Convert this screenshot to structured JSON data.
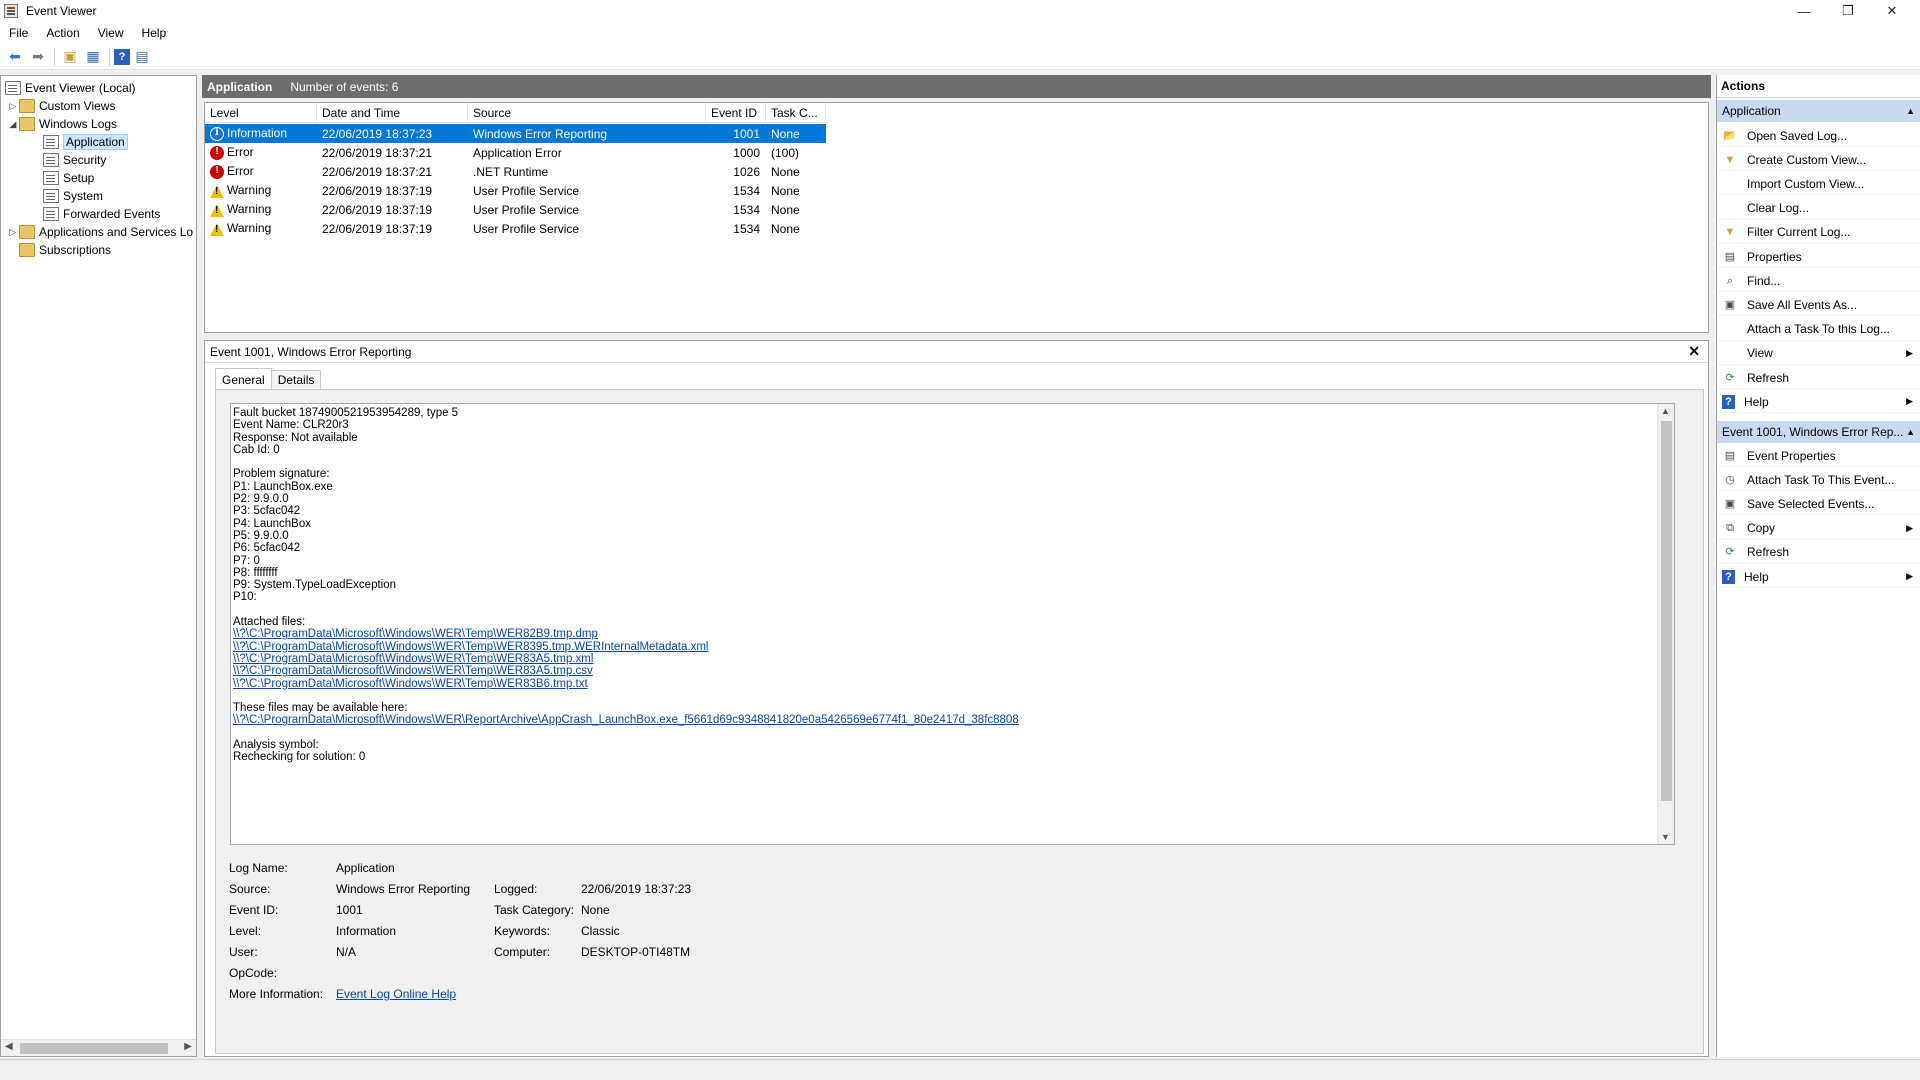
{
  "window": {
    "title": "Event Viewer",
    "minimize": "—",
    "restore": "❐",
    "close": "✕"
  },
  "menu": [
    "File",
    "Action",
    "View",
    "Help"
  ],
  "toolbar": {
    "back": "⬅",
    "forward": "➡",
    "up": "▣",
    "show_hide": "▦",
    "help": "?",
    "console": "▤"
  },
  "tree": {
    "root": "Event Viewer (Local)",
    "custom_views": "Custom Views",
    "windows_logs": "Windows Logs",
    "logs": [
      "Application",
      "Security",
      "Setup",
      "System",
      "Forwarded Events"
    ],
    "apps_services": "Applications and Services Lo",
    "subscriptions": "Subscriptions",
    "selected": "Application"
  },
  "center": {
    "log_name": "Application",
    "count_text": "Number of events: 6",
    "columns": [
      "Level",
      "Date and Time",
      "Source",
      "Event ID",
      "Task C..."
    ],
    "rows": [
      {
        "level": "Information",
        "icon": "information-icon",
        "date": "22/06/2019 18:37:23",
        "source": "Windows Error Reporting",
        "event_id": "1001",
        "task": "None"
      },
      {
        "level": "Error",
        "icon": "error-icon",
        "date": "22/06/2019 18:37:21",
        "source": "Application Error",
        "event_id": "1000",
        "task": "(100)"
      },
      {
        "level": "Error",
        "icon": "error-icon",
        "date": "22/06/2019 18:37:21",
        "source": ".NET Runtime",
        "event_id": "1026",
        "task": "None"
      },
      {
        "level": "Warning",
        "icon": "warning-icon",
        "date": "22/06/2019 18:37:19",
        "source": "User Profile Service",
        "event_id": "1534",
        "task": "None"
      },
      {
        "level": "Warning",
        "icon": "warning-icon",
        "date": "22/06/2019 18:37:19",
        "source": "User Profile Service",
        "event_id": "1534",
        "task": "None"
      },
      {
        "level": "Warning",
        "icon": "warning-icon",
        "date": "22/06/2019 18:37:19",
        "source": "User Profile Service",
        "event_id": "1534",
        "task": "None"
      }
    ]
  },
  "detail": {
    "title": "Event 1001, Windows Error Reporting",
    "close": "✕",
    "tabs": [
      "General",
      "Details"
    ],
    "description_lines": [
      "Fault bucket 1874900521953954289, type 5",
      "Event Name: CLR20r3",
      "Response: Not available",
      "Cab Id: 0",
      "",
      "Problem signature:",
      "P1: LaunchBox.exe",
      "P2: 9.9.0.0",
      "P3: 5cfac042",
      "P4: LaunchBox",
      "P5: 9.9.0.0",
      "P6: 5cfac042",
      "P7: 0",
      "P8: ffffffff",
      "P9: System.TypeLoadException",
      "P10:",
      "",
      "Attached files:"
    ],
    "attached_files": [
      "\\\\?\\C:\\ProgramData\\Microsoft\\Windows\\WER\\Temp\\WER82B9.tmp.dmp",
      "\\\\?\\C:\\ProgramData\\Microsoft\\Windows\\WER\\Temp\\WER8395.tmp.WERInternalMetadata.xml",
      "\\\\?\\C:\\ProgramData\\Microsoft\\Windows\\WER\\Temp\\WER83A5.tmp.xml",
      "\\\\?\\C:\\ProgramData\\Microsoft\\Windows\\WER\\Temp\\WER83A5.tmp.csv",
      "\\\\?\\C:\\ProgramData\\Microsoft\\Windows\\WER\\Temp\\WER83B6.tmp.txt"
    ],
    "available_here_label": "These files may be available here:",
    "archive_path": "\\\\?\\C:\\ProgramData\\Microsoft\\Windows\\WER\\ReportArchive\\AppCrash_LaunchBox.exe_f5661d69c9348841820e0a5426569e6774f1_80e2417d_38fc8808",
    "analysis_lines": [
      "Analysis symbol:",
      "Rechecking for solution: 0"
    ],
    "props": {
      "log_name_label": "Log Name:",
      "log_name": "Application",
      "source_label": "Source:",
      "source": "Windows Error Reporting",
      "logged_label": "Logged:",
      "logged": "22/06/2019 18:37:23",
      "event_id_label": "Event ID:",
      "event_id": "1001",
      "task_category_label": "Task Category:",
      "task_category": "None",
      "level_label": "Level:",
      "level": "Information",
      "keywords_label": "Keywords:",
      "keywords": "Classic",
      "user_label": "User:",
      "user": "N/A",
      "computer_label": "Computer:",
      "computer": "DESKTOP-0TI48TM",
      "opcode_label": "OpCode:",
      "more_info_label": "More Information:",
      "more_info_link": "Event Log Online Help"
    }
  },
  "actions": {
    "title": "Actions",
    "section1": "Application",
    "items1": [
      {
        "label": "Open Saved Log...",
        "icon": "folder-open-icon",
        "glyph": "📂",
        "submenu": false
      },
      {
        "label": "Create Custom View...",
        "icon": "filter-icon",
        "glyph": "▼",
        "submenu": false
      },
      {
        "label": "Import Custom View...",
        "icon": "",
        "glyph": "",
        "submenu": false
      },
      {
        "label": "Clear Log...",
        "icon": "",
        "glyph": "",
        "submenu": false
      },
      {
        "label": "Filter Current Log...",
        "icon": "filter-icon",
        "glyph": "▼",
        "submenu": false
      },
      {
        "label": "Properties",
        "icon": "properties-icon",
        "glyph": "▤",
        "submenu": false
      },
      {
        "label": "Find...",
        "icon": "binoculars-icon",
        "glyph": "⌕",
        "submenu": false
      },
      {
        "label": "Save All Events As...",
        "icon": "save-icon",
        "glyph": "▣",
        "submenu": false
      },
      {
        "label": "Attach a Task To this Log...",
        "icon": "",
        "glyph": "",
        "submenu": false
      },
      {
        "label": "View",
        "icon": "",
        "glyph": "",
        "submenu": true
      },
      {
        "label": "Refresh",
        "icon": "refresh-icon",
        "glyph": "⟳",
        "submenu": false
      },
      {
        "label": "Help",
        "icon": "help-icon",
        "glyph": "?",
        "submenu": true
      }
    ],
    "section2": "Event 1001, Windows Error Rep...",
    "items2": [
      {
        "label": "Event Properties",
        "icon": "properties-icon",
        "glyph": "▤",
        "submenu": false
      },
      {
        "label": "Attach Task To This Event...",
        "icon": "task-icon",
        "glyph": "◷",
        "submenu": false
      },
      {
        "label": "Save Selected Events...",
        "icon": "save-icon",
        "glyph": "▣",
        "submenu": false
      },
      {
        "label": "Copy",
        "icon": "copy-icon",
        "glyph": "⧉",
        "submenu": true
      },
      {
        "label": "Refresh",
        "icon": "refresh-icon",
        "glyph": "⟳",
        "submenu": false
      },
      {
        "label": "Help",
        "icon": "help-icon",
        "glyph": "?",
        "submenu": true
      }
    ]
  }
}
